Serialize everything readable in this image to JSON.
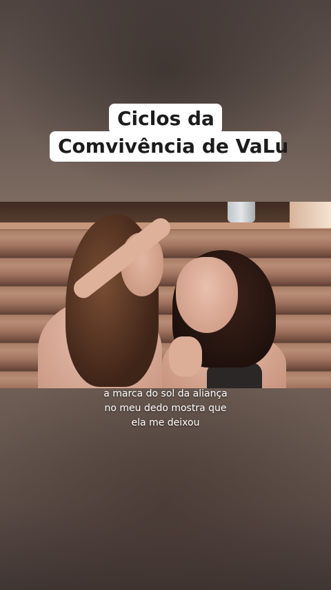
{
  "title": {
    "line1": "Ciclos da",
    "line2": "Comvivência de VaLu"
  },
  "caption": {
    "lines": [
      "a marca do sol da aliança",
      "no meu dedo mostra que",
      "ela me deixou"
    ]
  },
  "colors": {
    "title_bg": "#ffffff",
    "title_text": "#1c1c1c",
    "caption_text": "#ffffff"
  }
}
